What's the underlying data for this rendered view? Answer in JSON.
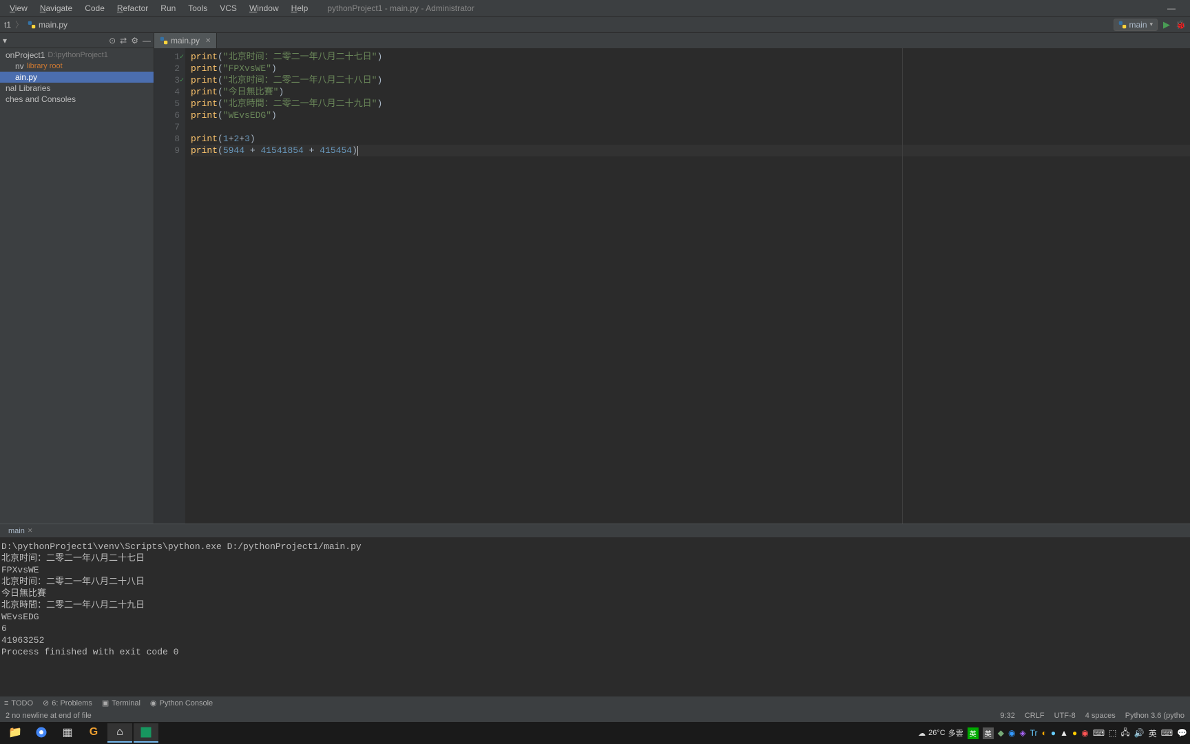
{
  "window": {
    "title": "pythonProject1 - main.py - Administrator"
  },
  "menu": {
    "view": "View",
    "navigate": "Navigate",
    "code": "Code",
    "refactor": "Refactor",
    "run": "Run",
    "tools": "Tools",
    "vcs": "VCS",
    "window": "Window",
    "help": "Help"
  },
  "nav": {
    "project": "t1",
    "file": "main.py",
    "run_config": "main"
  },
  "sidebar": {
    "tree": [
      {
        "label": "onProject1",
        "path": "D:\\pythonProject1",
        "indent": 0
      },
      {
        "label": "nv",
        "lib": "library root",
        "indent": 1
      },
      {
        "label": "ain.py",
        "indent": 1,
        "selected": true
      },
      {
        "label": "nal Libraries",
        "indent": 0
      },
      {
        "label": "ches and Consoles",
        "indent": 0
      }
    ]
  },
  "tabs": {
    "active": "main.py"
  },
  "code": {
    "lines": [
      {
        "n": 1,
        "mark": "ok",
        "tokens": [
          [
            "fn",
            "print"
          ],
          [
            "par",
            "("
          ],
          [
            "str",
            "\"北京时间：二零二一年八月二十七日\""
          ],
          [
            "par",
            ")"
          ]
        ]
      },
      {
        "n": 2,
        "tokens": [
          [
            "fn",
            "print"
          ],
          [
            "par",
            "("
          ],
          [
            "str",
            "\"FPXvsWE\""
          ],
          [
            "par",
            ")"
          ]
        ]
      },
      {
        "n": 3,
        "mark": "ok",
        "tokens": [
          [
            "fn",
            "print"
          ],
          [
            "par",
            "("
          ],
          [
            "str",
            "\"北京时间：二零二一年八月二十八日\""
          ],
          [
            "par",
            ")"
          ]
        ]
      },
      {
        "n": 4,
        "tokens": [
          [
            "fn",
            "print"
          ],
          [
            "par",
            "("
          ],
          [
            "str",
            "\"今日無比賽\""
          ],
          [
            "par",
            ")"
          ]
        ]
      },
      {
        "n": 5,
        "tokens": [
          [
            "fn",
            "print"
          ],
          [
            "par",
            "("
          ],
          [
            "str",
            "\"北京時間：二零二一年八月二十九日\""
          ],
          [
            "par",
            ")"
          ]
        ]
      },
      {
        "n": 6,
        "tokens": [
          [
            "fn",
            "print"
          ],
          [
            "par",
            "("
          ],
          [
            "str",
            "\"WEvsEDG\""
          ],
          [
            "par",
            ")"
          ]
        ]
      },
      {
        "n": 7,
        "tokens": []
      },
      {
        "n": 8,
        "tokens": [
          [
            "fn",
            "print"
          ],
          [
            "par",
            "("
          ],
          [
            "num",
            "1"
          ],
          [
            "op",
            "+"
          ],
          [
            "num",
            "2"
          ],
          [
            "op",
            "+"
          ],
          [
            "num",
            "3"
          ],
          [
            "par",
            ")"
          ]
        ]
      },
      {
        "n": 9,
        "hl": true,
        "tokens": [
          [
            "fn",
            "print"
          ],
          [
            "par",
            "("
          ],
          [
            "num",
            "5944"
          ],
          [
            "op",
            " + "
          ],
          [
            "num",
            "41541854"
          ],
          [
            "op",
            " + "
          ],
          [
            "num",
            "415454"
          ],
          [
            "par",
            ")"
          ]
        ],
        "caret": true
      }
    ]
  },
  "run": {
    "tab": "main",
    "output": [
      "D:\\pythonProject1\\venv\\Scripts\\python.exe D:/pythonProject1/main.py",
      "北京时间：二零二一年八月二十七日",
      "FPXvsWE",
      "北京时间：二零二一年八月二十八日",
      "今日無比賽",
      "北京時間：二零二一年八月二十九日",
      "WEvsEDG",
      "6",
      "41963252",
      "",
      "Process finished with exit code 0"
    ]
  },
  "bottom": {
    "todo": "TODO",
    "problems": "6: Problems",
    "terminal": "Terminal",
    "pyconsole": "Python Console"
  },
  "status": {
    "message": "2 no newline at end of file",
    "pos": "9:32",
    "eol": "CRLF",
    "encoding": "UTF-8",
    "indent": "4 spaces",
    "interpreter": "Python 3.6 (pytho"
  },
  "taskbar": {
    "weather_temp": "26°C",
    "weather_text": "多雲",
    "ime1": "英",
    "ime2": "英",
    "ime_lang": "英"
  }
}
